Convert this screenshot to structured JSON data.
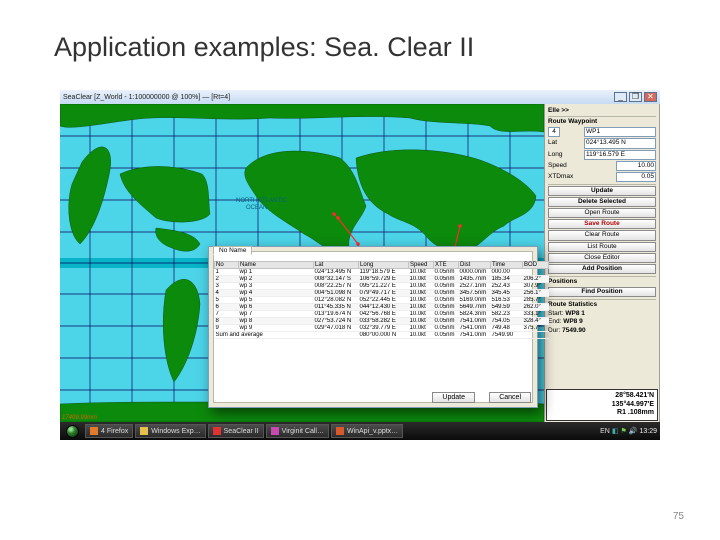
{
  "slide": {
    "title": "Application examples: Sea. Clear II",
    "number": "75"
  },
  "window_title": "SeaClear [Z_World - 1:100000000 @ 100%] — [Rt=4]",
  "window_controls": {
    "min": "_",
    "max": "❐",
    "close": "✕"
  },
  "panel": {
    "close": "Elle  >>",
    "title": "Route Waypoint",
    "wp_index": "4",
    "wp_name": "WP1",
    "lat_label": "Lat",
    "lat": "024°13.495 N",
    "lng_label": "Long",
    "lng": "119°16.579 E",
    "speed_label": "Speed",
    "speed": "10.00",
    "xtd_label": "XTDmax",
    "xtd": "0.05",
    "btns": [
      {
        "label": "Update",
        "cls": "b"
      },
      {
        "label": "Delete Selected",
        "cls": "b"
      },
      {
        "label": "Open Route",
        "cls": ""
      },
      {
        "label": "Save Route",
        "cls": "red"
      },
      {
        "label": "Clear Route",
        "cls": ""
      },
      {
        "label": "List Route",
        "cls": ""
      },
      {
        "label": "Close Editor",
        "cls": ""
      },
      {
        "label": "Add Position",
        "cls": "b"
      }
    ],
    "positions_label": "Positions",
    "find_label": "Find Position",
    "rsumm_label": "Route Statistics",
    "start_label": "Start:",
    "start_val": "WP8 1",
    "end_label": "End:",
    "end_val": "WP8 9",
    "dur_label": "Dur:",
    "dur_val": "7549.90"
  },
  "map": {
    "corner": "17409.99mm"
  },
  "statusbox": {
    "l1": "28°58.421'N",
    "l2": "135°44.997'E",
    "l3": "R1  .108mm"
  },
  "dialog": {
    "tab": "No Name",
    "cols": [
      "No",
      "Name",
      "Lat",
      "Long",
      "Speed",
      "XTE",
      "Dist",
      "Time",
      "BOD"
    ],
    "rows": [
      [
        "1",
        "wp 1",
        "024°13.495 N",
        "119°18.579 E",
        "10.0kt",
        "0.05nm",
        "0000.0nm",
        "000.00",
        ""
      ],
      [
        "2",
        "wp 2",
        "008°32.147 S",
        "106°59.729 E",
        "10.0kt",
        "0.05nm",
        "1435.7nm",
        "185.34",
        "206.2°"
      ],
      [
        "3",
        "wp 3",
        "008°22.257 N",
        "095°21.227 E",
        "10.0kt",
        "0.05nm",
        "2527.1nm",
        "252.43",
        "307.9°"
      ],
      [
        "4",
        "wp 4",
        "004°51.098 N",
        "079°49.717 E",
        "10.0kt",
        "0.05nm",
        "3457.5nm",
        "345.45",
        "256.1°"
      ],
      [
        "5",
        "wp 5",
        "012°28.082 N",
        "052°22.445 E",
        "10.0kt",
        "0.05nm",
        "5169.0nm",
        "516.53",
        "285.7°"
      ],
      [
        "6",
        "wp 6",
        "011°45.335 N",
        "044°12.430 E",
        "10.0kt",
        "0.05nm",
        "5649.7nm",
        "549.59",
        "262.0°"
      ],
      [
        "7",
        "wp 7",
        "013°19.674 N",
        "042°56.768 E",
        "10.0kt",
        "0.05nm",
        "5824.3nm",
        "582.23",
        "333.1°"
      ],
      [
        "8",
        "wp 8",
        "027°53.724 N",
        "033°58.282 E",
        "10.0kt",
        "0.05nm",
        "7541.0nm",
        "754.05",
        "328.4°"
      ],
      [
        "9",
        "wp 9",
        "029°47.018 N",
        "032°39.779 E",
        "10.0kt",
        "0.05nm",
        "7541.0nm",
        "749.48",
        "375.7°"
      ]
    ],
    "sum_label": "Sum and average",
    "sum": [
      "080°00.000 N",
      "10.0kt",
      "0.05nm",
      "7541.0nm",
      "7549.90",
      ""
    ],
    "update": "Update",
    "cancel": "Cancel"
  },
  "taskbar": {
    "items": [
      {
        "label": "4 Firefox",
        "color": "#e27a2a"
      },
      {
        "label": "Windows Exp…",
        "color": "#e4c04c"
      },
      {
        "label": "SeaClear II",
        "color": "#d33"
      },
      {
        "label": "Virginit Call…",
        "color": "#c64ab0"
      },
      {
        "label": "WinApi_v.pptx…",
        "color": "#d65a2c"
      }
    ],
    "tray": {
      "lang": "EN",
      "clock": "13:29"
    }
  }
}
